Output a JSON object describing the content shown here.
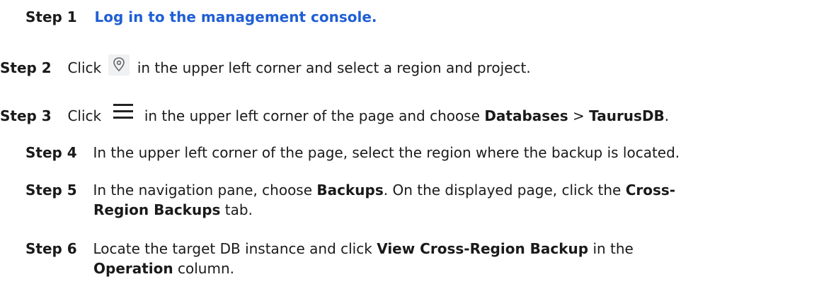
{
  "steps": [
    {
      "label": "Step 1",
      "link": "Log in to the management console."
    },
    {
      "label": "Step 2",
      "a": "Click",
      "b": "in the upper left corner and select a region and project."
    },
    {
      "label": "Step 3",
      "a": "Click",
      "b": "in the upper left corner of the page and choose",
      "bold1": "Databases",
      "sep": ">",
      "bold2": "TaurusDB",
      "end": "."
    },
    {
      "label": "Step 4",
      "a": "In the upper left corner of the page, select the region where the backup is located."
    },
    {
      "label": "Step 5",
      "a": "In the navigation pane, choose",
      "bold1": "Backups",
      "b": ". On the displayed page, click the",
      "bold2": "Cross-",
      "bold3": "Region Backups",
      "c": "tab."
    },
    {
      "label": "Step 6",
      "a": "Locate the target DB instance and click",
      "bold1": "View Cross-Region Backup",
      "b": "in the",
      "bold2": "Operation",
      "c": "column."
    }
  ],
  "icons": {
    "step2": "location-pin-icon",
    "step3": "menu-hamburger-icon"
  }
}
